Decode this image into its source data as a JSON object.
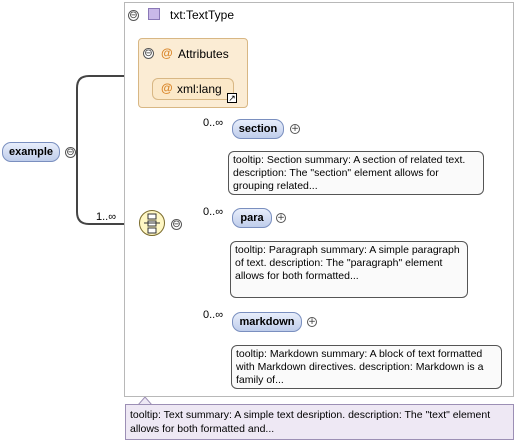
{
  "type": {
    "name": "txt:TextType",
    "toggle": "⊖"
  },
  "attributes": {
    "title": "Attributes",
    "toggle": "⊖",
    "item": "xml:lang",
    "ref_glyph": "↗",
    "at": "@"
  },
  "root": {
    "name": "example",
    "toggle": "⊖",
    "cardinality": "1..∞"
  },
  "sequence": {
    "toggle": "⊖"
  },
  "children": [
    {
      "name": "section",
      "cardinality": "0..∞",
      "plus": "+",
      "tooltip": "tooltip: Section summary: A section of related text. description: The \"section\" element allows for grouping related..."
    },
    {
      "name": "para",
      "cardinality": "0..∞",
      "plus": "+",
      "tooltip": "tooltip: Paragraph summary: A simple paragraph of text. description: The \"paragraph\" element allows for both formatted..."
    },
    {
      "name": "markdown",
      "cardinality": "0..∞",
      "plus": "+",
      "tooltip": "tooltip: Markdown summary: A block of text formatted with Markdown directives. description: Markdown is a family of..."
    }
  ],
  "bottom_tooltip": "tooltip: Text summary: A simple text desription. description: The \"text\" element allows for both formatted and...",
  "colors": {
    "element_fill": "#bfcdeb",
    "attr_fill": "#fbecd4",
    "sequence_fill": "#fff7c4",
    "type_swatch": "#c9b8e8"
  }
}
